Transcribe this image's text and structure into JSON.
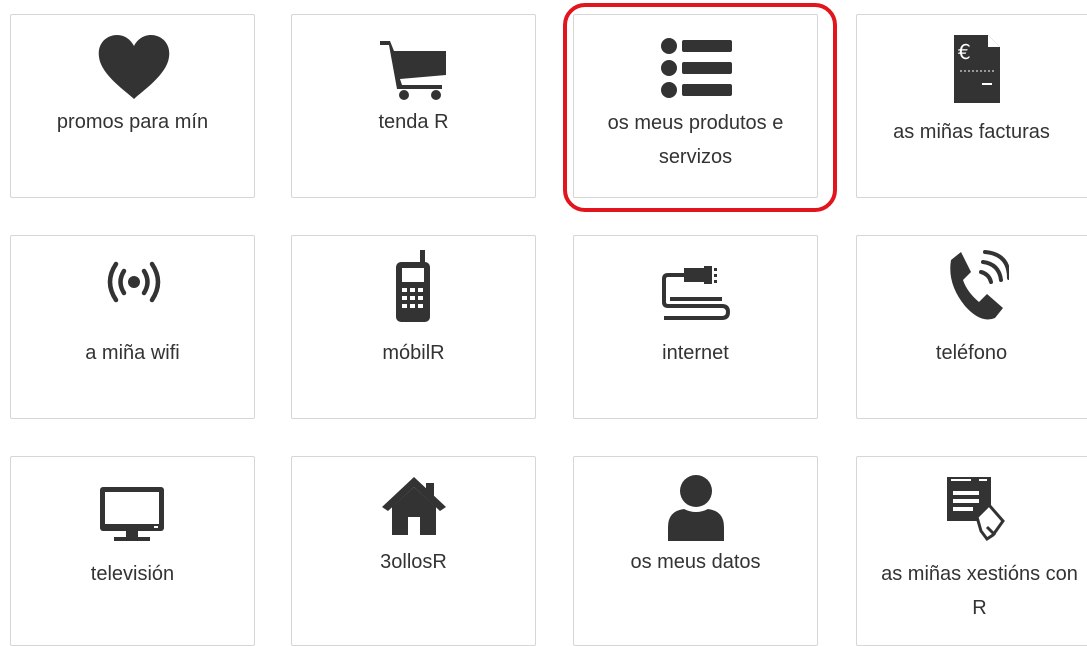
{
  "tiles": [
    {
      "label": "promos para mín",
      "icon": "heart-icon"
    },
    {
      "label": "tenda R",
      "icon": "shopping-cart-icon"
    },
    {
      "label": "os meus produtos e servizos",
      "icon": "list-icon"
    },
    {
      "label": "as miñas facturas",
      "icon": "invoice-euro-icon"
    },
    {
      "label": "a miña wifi",
      "icon": "wifi-signal-icon"
    },
    {
      "label": "móbilR",
      "icon": "mobile-phone-icon"
    },
    {
      "label": "internet",
      "icon": "network-cable-icon"
    },
    {
      "label": "teléfono",
      "icon": "phone-icon"
    },
    {
      "label": "televisión",
      "icon": "tv-icon"
    },
    {
      "label": "3ollosR",
      "icon": "home-icon"
    },
    {
      "label": "os meus datos",
      "icon": "user-icon"
    },
    {
      "label": "as miñas xestións con R",
      "icon": "management-form-icon"
    }
  ],
  "highlighted_tile": "os meus produtos e servizos",
  "colors": {
    "icon": "#333333",
    "highlight_border": "#e2141d",
    "tile_border": "#d6d6d6"
  }
}
